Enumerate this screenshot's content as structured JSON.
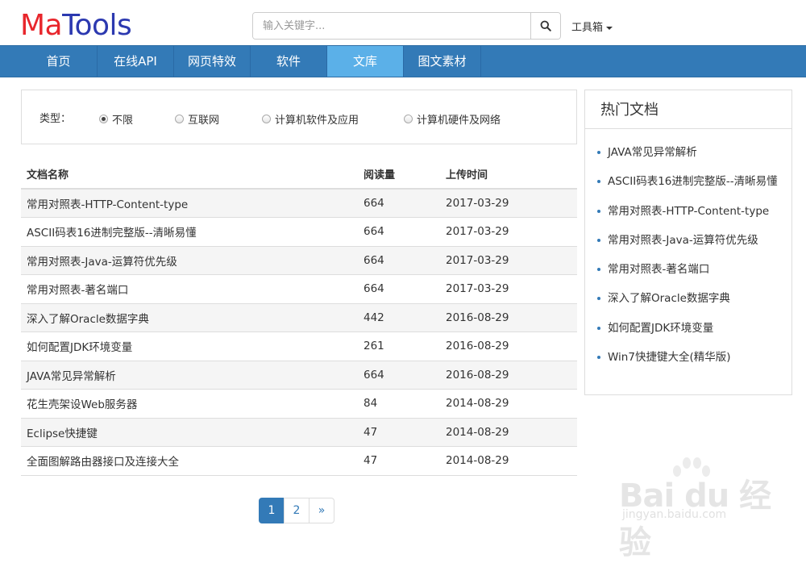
{
  "logo": {
    "part1": "Ma",
    "part2": "Tools"
  },
  "search": {
    "placeholder": "输入关键字...",
    "value": ""
  },
  "toolbox_label": "工具箱",
  "nav": {
    "items": [
      {
        "label": "首页"
      },
      {
        "label": "在线API"
      },
      {
        "label": "网页特效"
      },
      {
        "label": "软件"
      },
      {
        "label": "文库"
      },
      {
        "label": "图文素材"
      }
    ],
    "active_index": 4
  },
  "filter": {
    "label": "类型：",
    "options": [
      {
        "label": "不限",
        "checked": true
      },
      {
        "label": "互联网",
        "checked": false
      },
      {
        "label": "计算机软件及应用",
        "checked": false
      },
      {
        "label": "计算机硬件及网络",
        "checked": false
      }
    ]
  },
  "table": {
    "headers": {
      "name": "文档名称",
      "reads": "阅读量",
      "date": "上传时间"
    },
    "rows": [
      {
        "name": "常用对照表-HTTP-Content-type",
        "reads": "664",
        "date": "2017-03-29"
      },
      {
        "name": "ASCII码表16进制完整版--清晰易懂",
        "reads": "664",
        "date": "2017-03-29"
      },
      {
        "name": "常用对照表-Java-运算符优先级",
        "reads": "664",
        "date": "2017-03-29"
      },
      {
        "name": "常用对照表-著名端口",
        "reads": "664",
        "date": "2017-03-29"
      },
      {
        "name": "深入了解Oracle数据字典",
        "reads": "442",
        "date": "2016-08-29"
      },
      {
        "name": "如何配置JDK环境变量",
        "reads": "261",
        "date": "2016-08-29"
      },
      {
        "name": "JAVA常见异常解析",
        "reads": "664",
        "date": "2016-08-29"
      },
      {
        "name": "花生壳架设Web服务器",
        "reads": "84",
        "date": "2014-08-29"
      },
      {
        "name": "Eclipse快捷键",
        "reads": "47",
        "date": "2014-08-29"
      },
      {
        "name": "全面图解路由器接口及连接大全",
        "reads": "47",
        "date": "2014-08-29"
      }
    ]
  },
  "pagination": {
    "pages": [
      "1",
      "2"
    ],
    "next": "»",
    "current": "1"
  },
  "hot": {
    "title": "热门文档",
    "items": [
      "JAVA常见异常解析",
      "ASCII码表16进制完整版--清晰易懂",
      "常用对照表-HTTP-Content-type",
      "常用对照表-Java-运算符优先级",
      "常用对照表-著名端口",
      "深入了解Oracle数据字典",
      "如何配置JDK环境变量",
      "Win7快捷键大全(精华版)"
    ]
  },
  "watermark": {
    "text": "Bai du 经验",
    "sub": "jingyan.baidu.com"
  },
  "colors": {
    "nav": "#337ab7",
    "nav_active": "#5bb0e8",
    "logo_ma": "#e8262c",
    "logo_tools": "#2c39b0"
  }
}
